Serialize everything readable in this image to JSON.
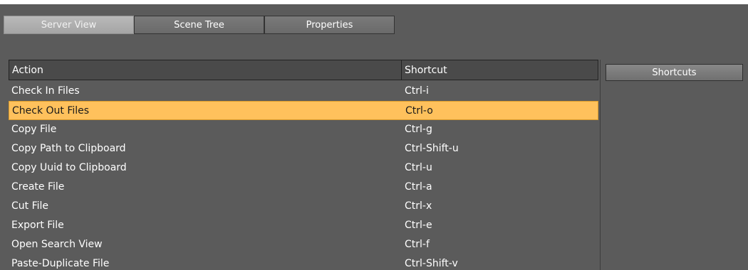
{
  "tabs": {
    "server_view": "Server View",
    "scene_tree": "Scene Tree",
    "properties": "Properties"
  },
  "table": {
    "headers": {
      "action": "Action",
      "shortcut": "Shortcut"
    },
    "rows": [
      {
        "action": "Check In Files",
        "shortcut": "Ctrl-i"
      },
      {
        "action": "Check Out Files",
        "shortcut": "Ctrl-o"
      },
      {
        "action": "Copy File",
        "shortcut": "Ctrl-g"
      },
      {
        "action": "Copy Path to Clipboard",
        "shortcut": "Ctrl-Shift-u"
      },
      {
        "action": "Copy Uuid to Clipboard",
        "shortcut": "Ctrl-u"
      },
      {
        "action": "Create File",
        "shortcut": "Ctrl-a"
      },
      {
        "action": "Cut File",
        "shortcut": "Ctrl-x"
      },
      {
        "action": "Export File",
        "shortcut": "Ctrl-e"
      },
      {
        "action": "Open Search View",
        "shortcut": "Ctrl-f"
      },
      {
        "action": "Paste-Duplicate File",
        "shortcut": "Ctrl-Shift-v"
      }
    ],
    "selected_index": 1
  },
  "side_button": {
    "label": "Shortcuts"
  },
  "colors": {
    "panel_bg": "#5b5b5b",
    "selected_row": "#ffc15c",
    "text": "#ffffff"
  }
}
